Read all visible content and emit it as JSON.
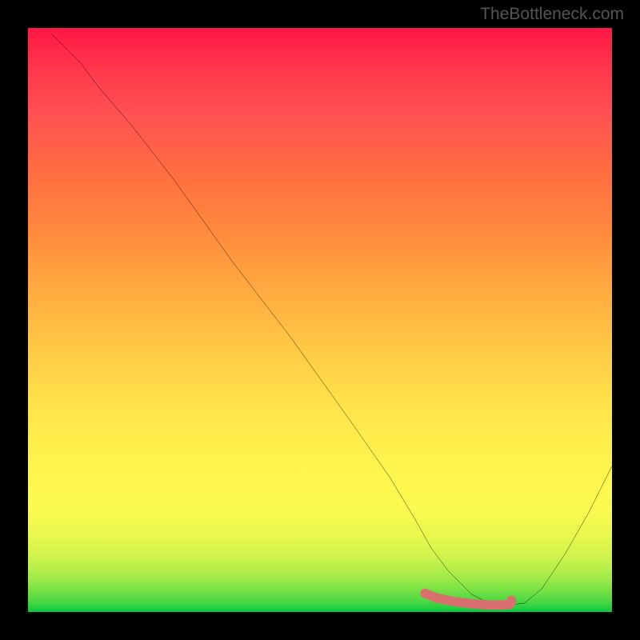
{
  "watermark": "TheBottleneck.com",
  "chart_data": {
    "type": "line",
    "title": "",
    "xlabel": "",
    "ylabel": "",
    "xlim": [
      0,
      100
    ],
    "ylim": [
      0,
      100
    ],
    "series": [
      {
        "name": "bottleneck-curve",
        "x": [
          4,
          6,
          9,
          12,
          18,
          25,
          35,
          45,
          55,
          62,
          66.5,
          69,
          72,
          76,
          79,
          81,
          82.5,
          85,
          88,
          92,
          96,
          100
        ],
        "values": [
          99,
          97,
          94,
          90,
          83,
          74,
          60,
          47,
          33,
          23,
          15.5,
          11,
          7,
          3,
          1.5,
          1.2,
          1.2,
          1.5,
          4,
          10,
          17,
          25
        ]
      },
      {
        "name": "highlight-band",
        "x": [
          68,
          70,
          73,
          76,
          79,
          81,
          82.5,
          82.8
        ],
        "values": [
          3.2,
          2.4,
          1.8,
          1.4,
          1.2,
          1.2,
          1.3,
          1.6
        ]
      }
    ],
    "highlight_dot": {
      "x": 82.8,
      "y": 2.0
    },
    "background_gradient": {
      "orientation": "vertical",
      "stops": [
        {
          "pos": 0.0,
          "color": "#ff1744"
        },
        {
          "pos": 0.15,
          "color": "#ff5252"
        },
        {
          "pos": 0.35,
          "color": "#ff8a3d"
        },
        {
          "pos": 0.55,
          "color": "#ffc945"
        },
        {
          "pos": 0.78,
          "color": "#fff84f"
        },
        {
          "pos": 0.92,
          "color": "#b8ef4a"
        },
        {
          "pos": 1.0,
          "color": "#00c83e"
        }
      ]
    }
  }
}
